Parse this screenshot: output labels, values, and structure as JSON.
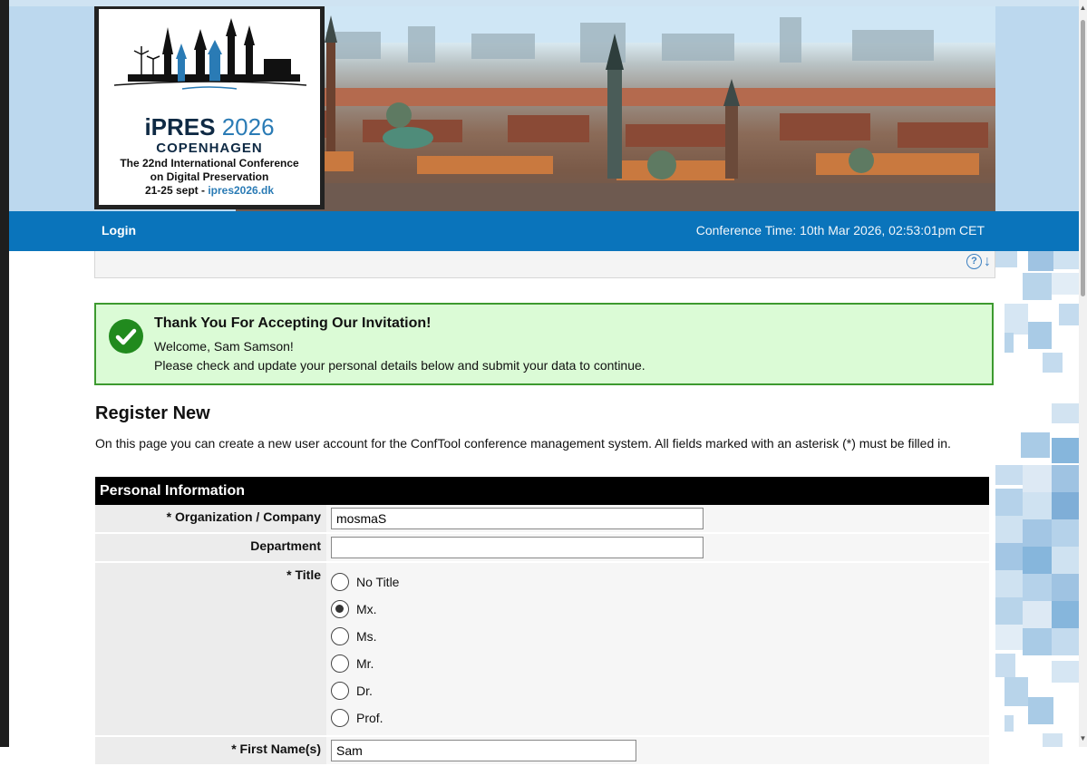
{
  "banner": {
    "logo_title": "iPRES",
    "logo_year": "2026",
    "logo_city": "COPENHAGEN",
    "logo_line1": "The 22nd International Conference",
    "logo_line2": "on Digital Preservation",
    "logo_dates": "21-25 sept - ",
    "logo_link": "ipres2026.dk"
  },
  "nav": {
    "login_label": "Login",
    "conference_time": "Conference Time: 10th Mar 2026, 02:53:01pm CET"
  },
  "help": {
    "help_icon": "?",
    "down_icon": "↓"
  },
  "success": {
    "title": "Thank You For Accepting Our Invitation!",
    "line1": "Welcome, Sam Samson!",
    "line2": "Please check and update your personal details below and submit your data to continue."
  },
  "register": {
    "title": "Register New",
    "intro": "On this page you can create a new user account for the ConfTool conference management system. All fields marked with an asterisk (*) must be filled in."
  },
  "form": {
    "section_title": "Personal Information",
    "organization_label": "* Organization / Company",
    "organization_value": "mosmaS",
    "department_label": "Department",
    "department_value": "",
    "title_label": "* Title",
    "title_options": [
      "No Title",
      "Mx.",
      "Ms.",
      "Mr.",
      "Dr.",
      "Prof."
    ],
    "title_selected": "Mx.",
    "first_name_label": "* First Name(s)",
    "first_name_value": "Sam"
  },
  "colors": {
    "nav_blue": "#0a74bb",
    "success_bg": "#dbfbd6",
    "success_border": "#3d9a2f",
    "check_green": "#218a1e"
  }
}
